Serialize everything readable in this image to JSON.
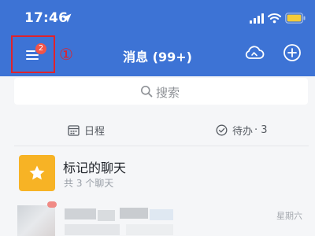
{
  "status_bar": {
    "time": "17:46",
    "icons": [
      "location-arrow-icon",
      "cellular-signal-icon",
      "wifi-icon",
      "battery-icon"
    ]
  },
  "nav": {
    "menu_badge": "2",
    "step_marker": "①",
    "title": "消息 (99+)",
    "icons": [
      "menu-icon",
      "cloud-sync-icon",
      "add-circle-icon"
    ]
  },
  "search": {
    "placeholder": "搜索",
    "icon": "search-icon"
  },
  "quick_links": {
    "schedule_label": "日程",
    "schedule_icon": "calendar-icon",
    "todo_label": "待办",
    "todo_count": "· 3",
    "todo_icon": "check-circle-icon"
  },
  "starred": {
    "title": "标记的聊天",
    "subtitle": "共 3 个聊天",
    "icon": "star-icon"
  },
  "conversation": {
    "weekday": "星期六"
  },
  "colors": {
    "header_bg": "#3d73d5",
    "highlight_red": "#e0222b",
    "star_tile": "#f7b325",
    "badge_red": "#f25449"
  }
}
